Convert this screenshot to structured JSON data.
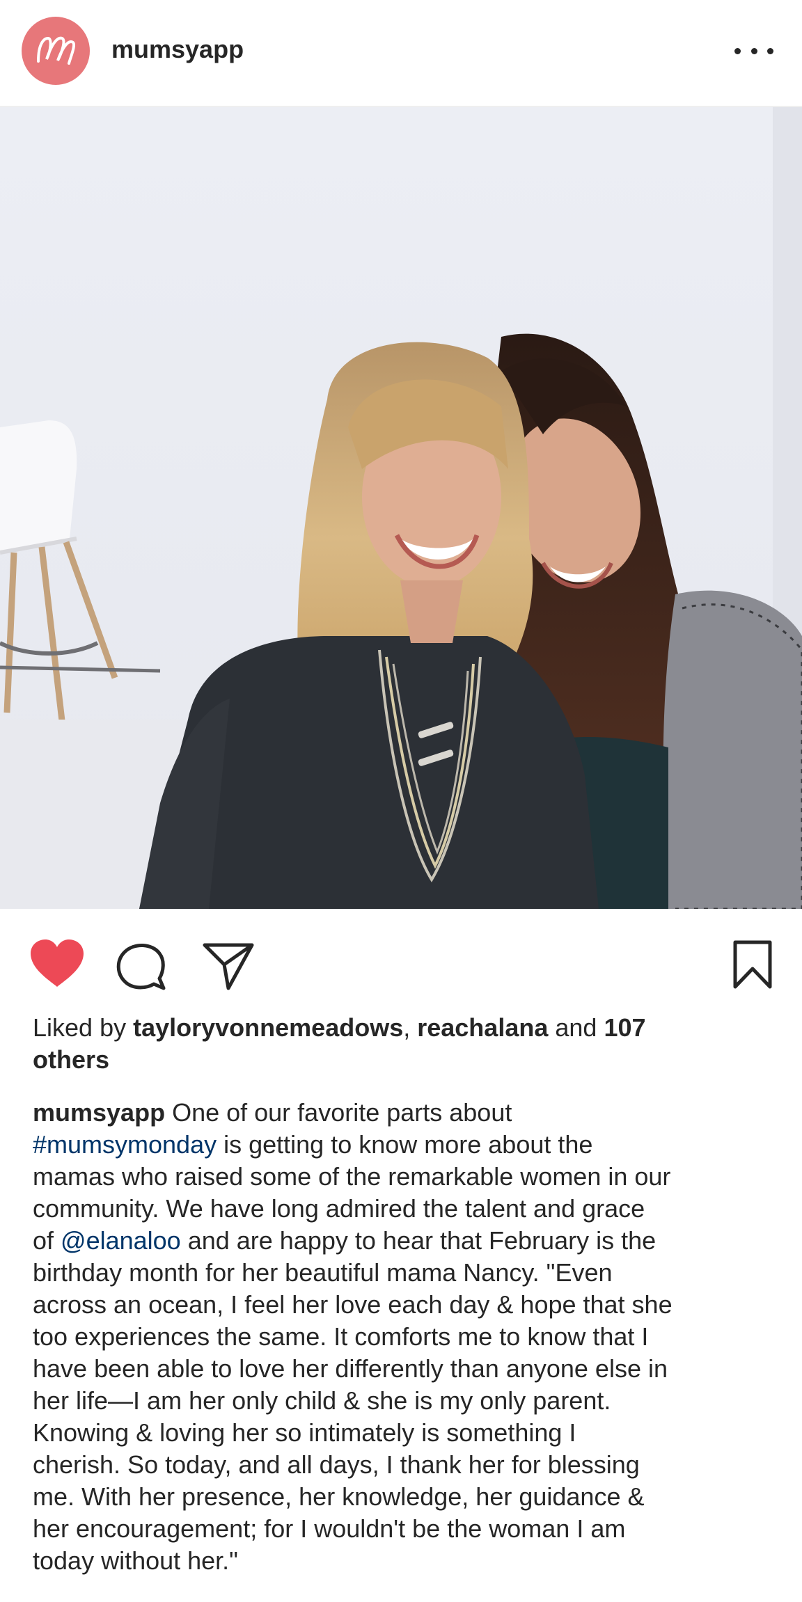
{
  "post": {
    "username": "mumsyapp",
    "avatar_letter": "M",
    "more_icon": "more-horizontal-icon"
  },
  "actions": {
    "like_icon": "heart-filled-icon",
    "comment_icon": "comment-icon",
    "share_icon": "send-icon",
    "save_icon": "bookmark-icon",
    "like_color": "#ed4956"
  },
  "likes": {
    "prefix": "Liked by ",
    "user1": "tayloryvonnemeadows",
    "sep": ", ",
    "user2": "reachalana",
    "and": " and ",
    "others_count": "107",
    "others_word": "others"
  },
  "caption": {
    "author": "mumsyapp",
    "lines": {
      "l1": " One of our favorite parts about",
      "l2_tag": "#mumsymonday",
      "l2": " is getting to know more about the",
      "l3": "mamas who raised some of the remarkable women in our",
      "l4": "community. We have long admired the talent and grace",
      "l5_pre": "of ",
      "l5_mention": "@elanaloo",
      "l5": " and are happy to hear that February is the",
      "l6": "birthday month for her beautiful mama Nancy. \"Even",
      "l7": "across an ocean, I feel her love each day & hope that she",
      "l8": "too experiences the same. It comforts me to know that I",
      "l9": "have been able to love her differently than anyone else in",
      "l10": "her life—I am her only child & she is my only parent.",
      "l11": "Knowing & loving her so intimately is something I",
      "l12": "cherish. So today, and all days, I thank her for blessing",
      "l13": "me. With her presence, her knowledge, her guidance &",
      "l14": "her encouragement; for I wouldn't be the woman I am",
      "l15": "today without her.\""
    }
  },
  "colors": {
    "avatar_bg": "#e7777a",
    "hashtag": "#003569",
    "text": "#262626"
  }
}
